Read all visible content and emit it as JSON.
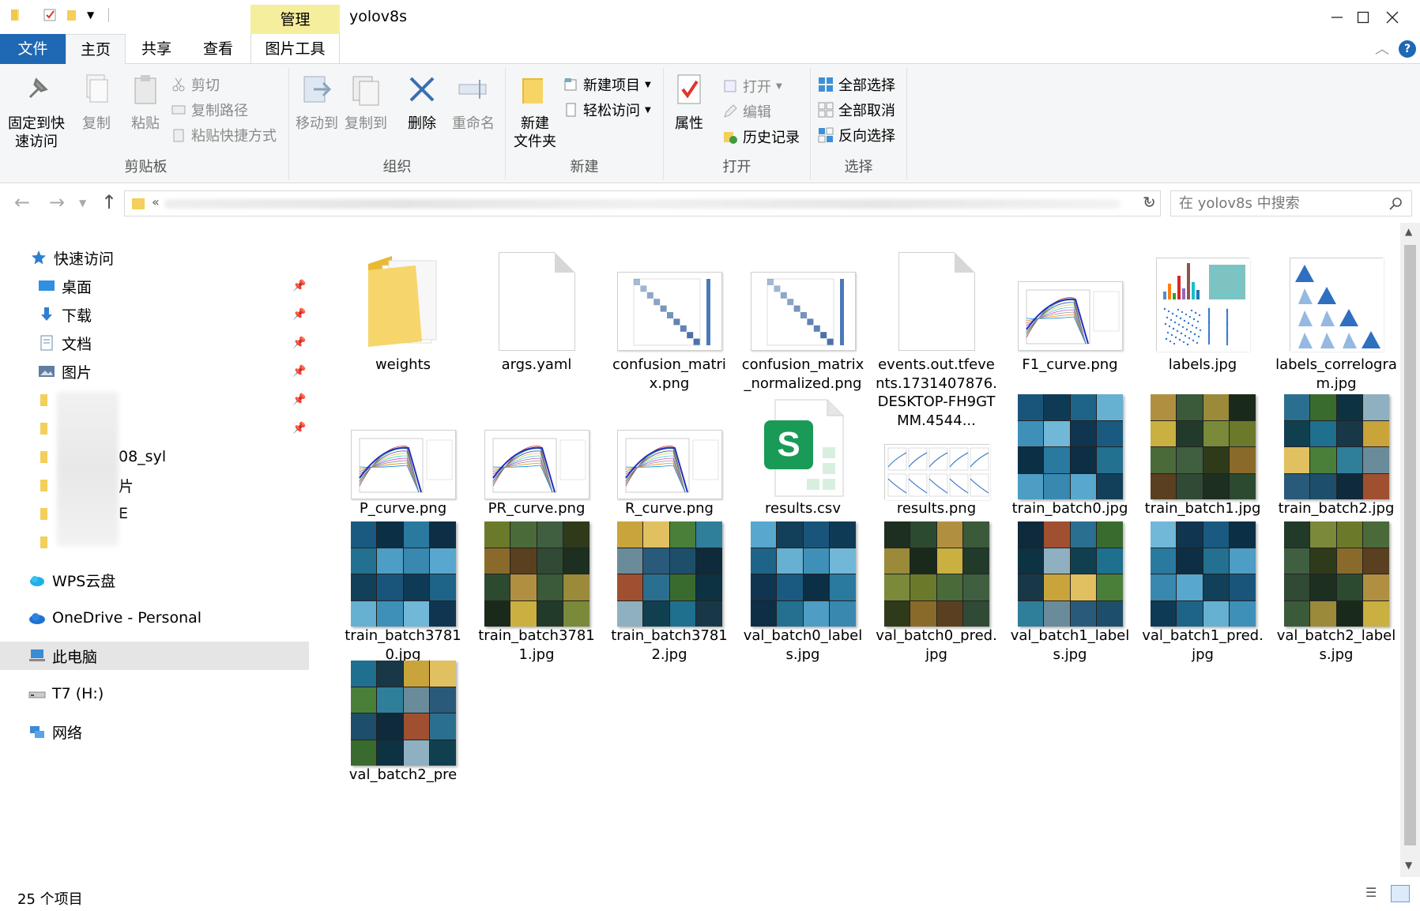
{
  "window": {
    "title": "yolov8s",
    "context_tab": "管理"
  },
  "tabs": [
    {
      "label": "文件"
    },
    {
      "label": "主页"
    },
    {
      "label": "共享"
    },
    {
      "label": "查看"
    },
    {
      "label": "图片工具"
    }
  ],
  "ribbon": {
    "clipboard": {
      "group": "剪贴板",
      "pin": "固定到快\n速访问",
      "copy": "复制",
      "paste": "粘贴",
      "cut": "剪切",
      "copy_path": "复制路径",
      "paste_shortcut": "粘贴快捷方式"
    },
    "organize": {
      "group": "组织",
      "move_to": "移动到",
      "copy_to": "复制到",
      "delete": "删除",
      "rename": "重命名"
    },
    "new": {
      "group": "新建",
      "new_folder": "新建\n文件夹",
      "new_item": "新建项目",
      "easy_access": "轻松访问"
    },
    "open": {
      "group": "打开",
      "properties": "属性",
      "open": "打开",
      "edit": "编辑",
      "history": "历史记录"
    },
    "select": {
      "group": "选择",
      "select_all": "全部选择",
      "select_none": "全部取消",
      "invert": "反向选择"
    }
  },
  "address": {
    "prefix": "«",
    "search_placeholder": "在 yolov8s 中搜索"
  },
  "nav": {
    "quick_access": "快速访问",
    "items": [
      "桌面",
      "下载",
      "文档",
      "图片"
    ],
    "partial": [
      "08_syl",
      "片",
      "E"
    ],
    "wps": "WPS云盘",
    "onedrive": "OneDrive - Personal",
    "this_pc": "此电脑",
    "drive": "T7 (H:)",
    "network": "网络"
  },
  "files": [
    {
      "name": "weights",
      "kind": "folder"
    },
    {
      "name": "args.yaml",
      "kind": "doc"
    },
    {
      "name": "confusion_matrix.png",
      "kind": "matrix"
    },
    {
      "name": "confusion_matrix_normalized.png",
      "kind": "matrix"
    },
    {
      "name": "events.out.tfevents.1731407876.DESKTOP-FH9GTMM.4544...",
      "kind": "doc"
    },
    {
      "name": "F1_curve.png",
      "kind": "curve"
    },
    {
      "name": "labels.jpg",
      "kind": "labels"
    },
    {
      "name": "labels_correlogram.jpg",
      "kind": "correlogram"
    },
    {
      "name": "P_curve.png",
      "kind": "curve"
    },
    {
      "name": "PR_curve.png",
      "kind": "curve"
    },
    {
      "name": "R_curve.png",
      "kind": "curve"
    },
    {
      "name": "results.csv",
      "kind": "csv"
    },
    {
      "name": "results.png",
      "kind": "results"
    },
    {
      "name": "train_batch0.jpg",
      "kind": "mosaic"
    },
    {
      "name": "train_batch1.jpg",
      "kind": "mosaic"
    },
    {
      "name": "train_batch2.jpg",
      "kind": "mosaic"
    },
    {
      "name": "train_batch37810.jpg",
      "kind": "mosaic"
    },
    {
      "name": "train_batch37811.jpg",
      "kind": "mosaic"
    },
    {
      "name": "train_batch37812.jpg",
      "kind": "mosaic"
    },
    {
      "name": "val_batch0_labels.jpg",
      "kind": "mosaic"
    },
    {
      "name": "val_batch0_pred.jpg",
      "kind": "mosaic"
    },
    {
      "name": "val_batch1_labels.jpg",
      "kind": "mosaic"
    },
    {
      "name": "val_batch1_pred.jpg",
      "kind": "mosaic"
    },
    {
      "name": "val_batch2_labels.jpg",
      "kind": "mosaic"
    },
    {
      "name": "val_batch2_pre",
      "kind": "mosaic"
    }
  ],
  "status": {
    "count": "25 个项目"
  }
}
